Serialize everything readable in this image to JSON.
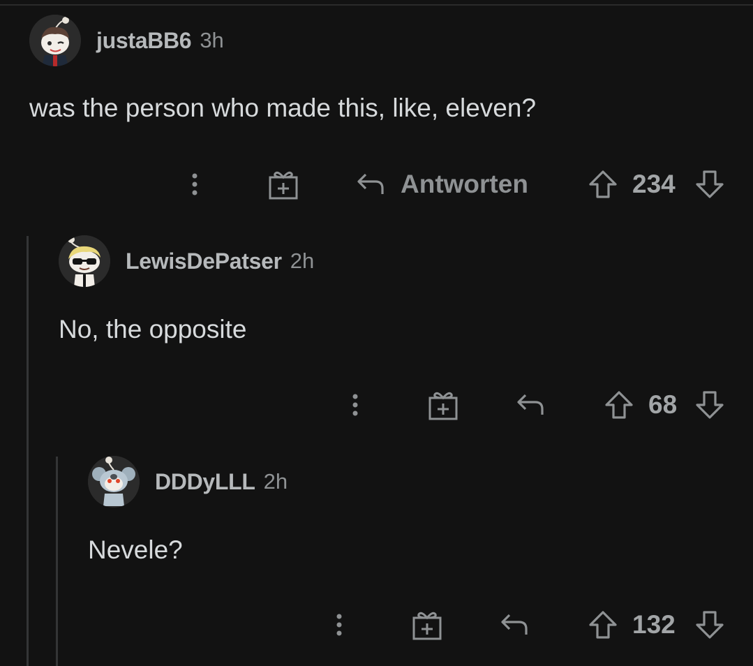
{
  "comments": [
    {
      "username": "justaBB6",
      "age": "3h",
      "body": "was the person who made this, like, eleven?",
      "reply_label": "Antworten",
      "score": "234",
      "avatar_icon": "snoo-avatar-icon"
    },
    {
      "username": "LewisDePatser",
      "age": "2h",
      "body": "No, the opposite",
      "reply_label": "",
      "score": "68",
      "avatar_icon": "snoo-sunglasses-avatar-icon"
    },
    {
      "username": "DDDyLLL",
      "age": "2h",
      "body": "Nevele?",
      "reply_label": "",
      "score": "132",
      "avatar_icon": "snoo-koala-avatar-icon"
    }
  ],
  "icons": {
    "more": "more-options-icon",
    "award": "award-gift-icon",
    "reply": "reply-arrow-icon",
    "upvote": "upvote-arrow-icon",
    "downvote": "downvote-arrow-icon"
  },
  "colors": {
    "background": "#121212",
    "text": "#d7dadc",
    "muted": "#8f9294",
    "thread_line": "#343536"
  }
}
